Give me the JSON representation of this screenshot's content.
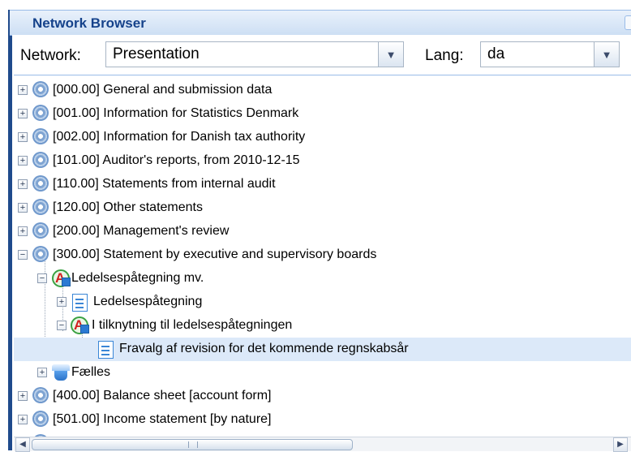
{
  "panel": {
    "title": "Network Browser"
  },
  "toolbar": {
    "network_label": "Network:",
    "network_value": "Presentation",
    "lang_label": "Lang:",
    "lang_value": "da"
  },
  "tree": {
    "items": [
      {
        "label": "[000.00] General and submission data",
        "icon": "gear-icon",
        "expanded": false
      },
      {
        "label": "[001.00] Information for Statistics Denmark",
        "icon": "gear-icon",
        "expanded": false
      },
      {
        "label": "[002.00] Information for Danish tax authority",
        "icon": "gear-icon",
        "expanded": false
      },
      {
        "label": "[101.00] Auditor's reports, from 2010-12-15",
        "icon": "gear-icon",
        "expanded": false
      },
      {
        "label": "[110.00] Statements from internal audit",
        "icon": "gear-icon",
        "expanded": false
      },
      {
        "label": "[120.00] Other statements",
        "icon": "gear-icon",
        "expanded": false
      },
      {
        "label": "[200.00] Management's review",
        "icon": "gear-icon",
        "expanded": false
      },
      {
        "label": "[300.00] Statement by executive and supervisory boards",
        "icon": "gear-icon",
        "expanded": true
      },
      {
        "label": "Ledelsespåtegning mv.",
        "icon": "abstract-element-icon",
        "expanded": true
      },
      {
        "label": "Ledelsespåtegning",
        "icon": "document-icon",
        "expanded": false
      },
      {
        "label": "I tilknytning til ledelsespåtegningen",
        "icon": "abstract-element-icon",
        "expanded": true
      },
      {
        "label": "Fravalg af revision for det kommende regnskabsår",
        "icon": "document-icon",
        "selected": true
      },
      {
        "label": "Fælles",
        "icon": "cube-icon",
        "expanded": false
      },
      {
        "label": "[400.00] Balance sheet [account form]",
        "icon": "gear-icon",
        "expanded": false
      },
      {
        "label": "[501.00] Income statement [by nature]",
        "icon": "gear-icon",
        "expanded": false
      }
    ]
  },
  "colors": {
    "title_text": "#15428b",
    "selection": "#dce9f9",
    "border": "#99bbe8"
  }
}
